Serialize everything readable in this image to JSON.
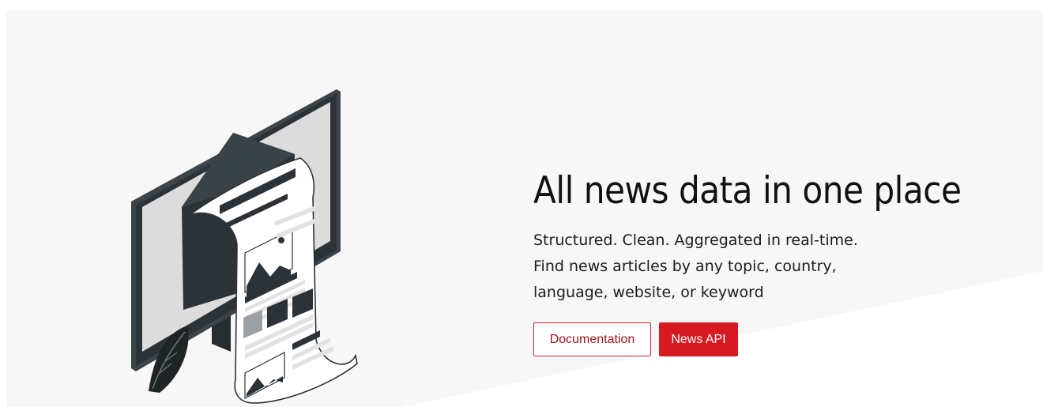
{
  "hero": {
    "headline": "All news data in one place",
    "lead_lines": [
      "Structured. Clean. Aggregated in real-time.",
      "Find news articles by any topic, country,",
      "language, website, or keyword"
    ],
    "buttons": {
      "documentation": "Documentation",
      "news_api": "News API"
    }
  },
  "illustration": {
    "icon": "monitor-with-newspaper-illustration"
  },
  "colors": {
    "accent": "#d71a21",
    "accent_dark": "#9c1419",
    "headline": "#111111",
    "illustration_dark": "#2b3338",
    "background": "#f7f7f7"
  }
}
